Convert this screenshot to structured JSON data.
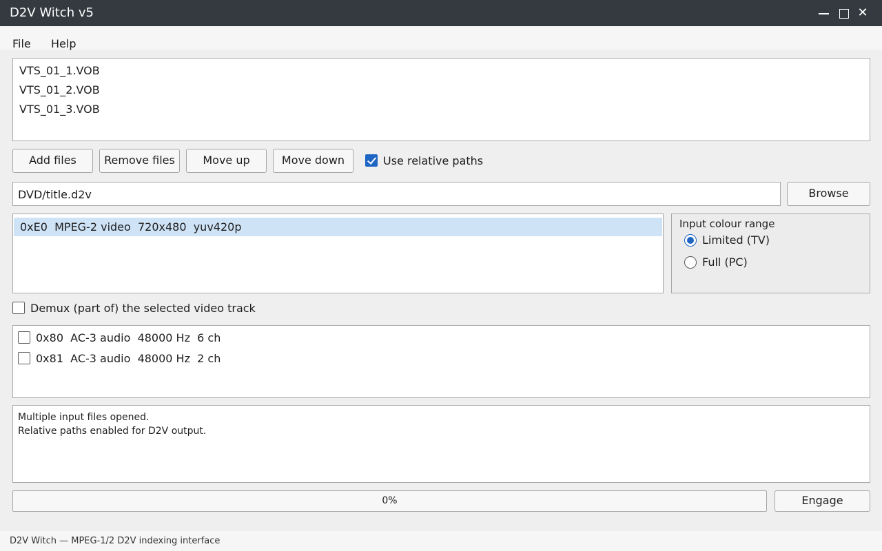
{
  "window": {
    "title": "D2V Witch v5",
    "close_glyph": "✕"
  },
  "menu": {
    "items": [
      "File",
      "Help"
    ]
  },
  "files": [
    "VTS_01_1.VOB",
    "VTS_01_2.VOB",
    "VTS_01_3.VOB"
  ],
  "buttons": {
    "add": "Add files",
    "remove": "Remove files",
    "up": "Move up",
    "down": "Move down",
    "browse": "Browse",
    "engage": "Engage"
  },
  "relative_paths": {
    "label": "Use relative paths",
    "checked": true
  },
  "output_path": "DVD/title.d2v",
  "video_tracks": [
    "0xE0  MPEG-2 video  720x480  yuv420p"
  ],
  "colour_range": {
    "title": "Input colour range",
    "options": [
      "Limited (TV)",
      "Full (PC)"
    ],
    "selected": "Limited (TV)"
  },
  "demux_video": {
    "label": "Demux (part of) the selected video track",
    "checked": false
  },
  "audio_tracks": [
    {
      "label": "0x80  AC-3 audio  48000 Hz  6 ch",
      "checked": false
    },
    {
      "label": "0x81  AC-3 audio  48000 Hz  2 ch",
      "checked": false
    }
  ],
  "log": [
    "Multiple input files opened.",
    "Relative paths enabled for D2V output."
  ],
  "progress": {
    "value": 0,
    "text": "0%"
  },
  "status": "D2V Witch — MPEG-1/2 D2V indexing interface",
  "colors": {
    "titlebar": "#353a41",
    "accent": "#1f66c4",
    "selection": "#cfe3f7"
  }
}
